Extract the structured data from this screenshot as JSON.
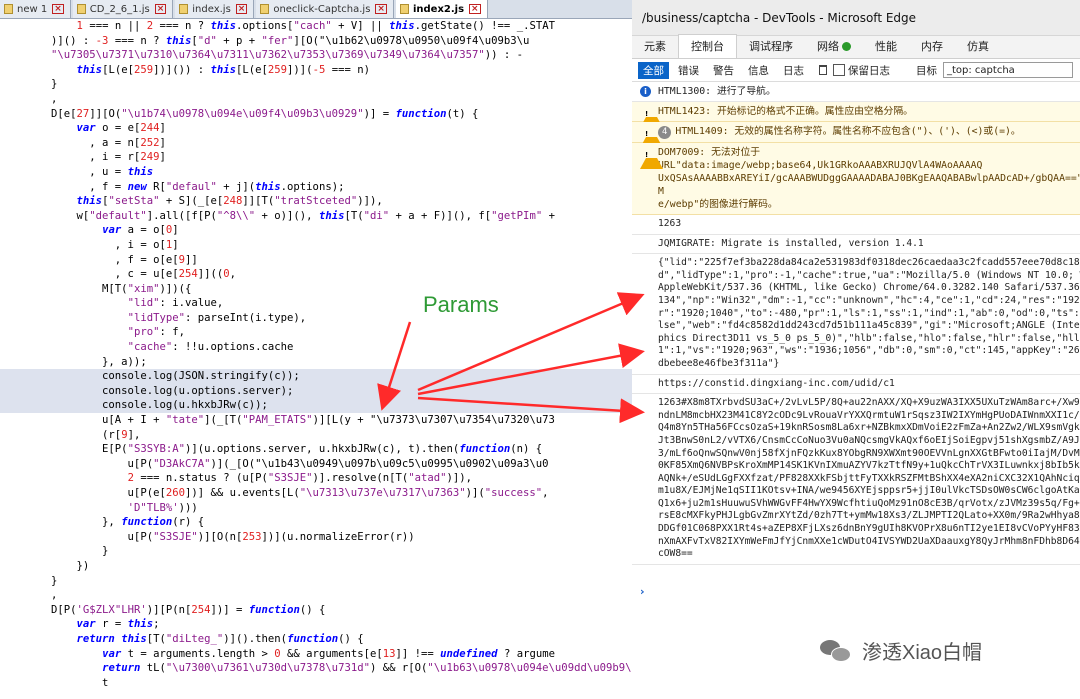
{
  "editor": {
    "tabs": [
      {
        "label": "new 1",
        "active": false
      },
      {
        "label": "CD_2_6_1.js",
        "active": false
      },
      {
        "label": "index.js",
        "active": false
      },
      {
        "label": "oneclick-Captcha.js",
        "active": false
      },
      {
        "label": "index2.js",
        "active": true
      }
    ],
    "lines": [
      "            1 === n || 2 === n ? this.options[\"cach\" + V] || this.getState() !== _.STAT",
      "        )]() : -3 === n ? this[\"d\" + p + \"fer\"][O(\"\\u1b62\\u0978\\u0950\\u09f4\\u09b3\\u",
      "        \"\\u7305\\u7371\\u7310\\u7364\\u7311\\u7362\\u7353\\u7369\\u7349\\u7364\\u7357\")) : -",
      "            this[L(e[259])]()) : this[L(e[259])](-5 === n)",
      "        }",
      "        ,",
      "        D[e[27]][O(\"\\u1b74\\u0978\\u094e\\u09f4\\u09b3\\u0929\")] = function(t) {",
      "            var o = e[244]",
      "              , a = n[252]",
      "              , i = r[249]",
      "              , u = this",
      "              , f = new R[\"defaul\" + j](this.options);",
      "            this[\"setSta\" + S](_[e[248]][T(\"tratStceted\")]),",
      "            w[\"default\"].all([f[P(\"^8\\\\\" + o)](), this[T(\"di\" + a + F)](), f[\"getPIm\" +",
      "                var a = o[0]",
      "                  , i = o[1]",
      "                  , f = o[e[9]]",
      "                  , c = u[e[254]]((0,",
      "                M[T(\"xim\")])({",
      "                    \"lid\": i.value,",
      "                    \"lidType\": parseInt(i.type),",
      "                    \"pro\": f,",
      "                    \"cache\": !!u.options.cache",
      "                }, a));",
      "                console.log(JSON.stringify(c));",
      "                console.log(u.options.server);",
      "                console.log(u.hkxbJRw(c));",
      "                u[A + I + \"tate\"](_[T(\"PAM_ETATS\")][L(y + \"\\u7373\\u7307\\u7354\\u7320\\u73",
      "                (r[9],",
      "                E[P(\"S3SYB:A\")](u.options.server, u.hkxbJRw(c), t).then(function(n) {",
      "                    u[P(\"D3AkC7A\")](_[O(\"\\u1b43\\u0949\\u097b\\u09c5\\u0995\\u0902\\u09a3\\u0",
      "                    2 === n.status ? (u[P(\"S3SJE\")].resolve(n[T(\"atad\")]),",
      "                    u[P(e[260])] && u.events[L(\"\\u7313\\u737e\\u7317\\u7363\")](\"success\",",
      "                    'D\"TLB%')))",
      "                }, function(r) {",
      "                    u[P(\"S3SJE\")][O(n[253])](u.normalizeError(r))",
      "                }",
      "            })",
      "        }",
      "        ,",
      "        D[P('G$ZLX\"LHR')][P(n[254])] = function() {",
      "            var r = this;",
      "            return this[T(\"diLteg_\")]().then(function() {",
      "                var t = arguments.length > 0 && arguments[e[13]] !== undefined ? argume",
      "                return tL(\"\\u7300\\u7361\\u730d\\u7378\\u731d\") && r[O(\"\\u1b63\\u0978\\u094e\\u09dd\\u09b9\\u0939\")](t.value),",
      "                t"
    ]
  },
  "overlay": {
    "params_label": "Params"
  },
  "devtools": {
    "title": "/business/captcha - DevTools - Microsoft Edge",
    "tabs": [
      "元素",
      "控制台",
      "调试程序",
      "网络",
      "性能",
      "内存",
      "仿真"
    ],
    "active_tab": "控制台",
    "filters": [
      "全部",
      "错误",
      "警告",
      "信息",
      "日志"
    ],
    "preserve_log": "保留日志",
    "target_label": "目标",
    "target_value": "_top: captcha",
    "messages": [
      {
        "type": "info",
        "text": "HTML1300: 进行了导航。"
      },
      {
        "type": "warn",
        "text": "HTML1423: 开始标记的格式不正确。属性应由空格分隔。"
      },
      {
        "type": "warn",
        "count": "4",
        "text": "HTML1409: 无效的属性名称字符。属性名称不应包含(\")、(')、(<)或(=)。"
      },
      {
        "type": "warn",
        "text": "DOM7009: 无法对位于 URL\"data:image/webp;base64,Uk1GRkoAAABXRUJQVlA4WAoAAAAQ\nUxQSAsAAAABBxAREYiI/gcAAABWUDggGAAAADABAJ0BKgEAAQABABwlpAADcAD+/gbQAA==\"且 M\ne/webp\"的图像进行解码。"
      }
    ],
    "log_1263": "1263",
    "jqmigrate": "JQMIGRATE: Migrate is installed, version 1.4.1",
    "json_lines": [
      "{\"lid\":\"225f7ef3ba228da84ca2e531983df0318dec26caedaa3c2fcadd557eee70d8c18",
      "d\",\"lidType\":1,\"pro\":-1,\"cache\":true,\"ua\":\"Mozilla/5.0 (Windows NT 10.0; Wi",
      "AppleWebKit/537.36 (KHTML, like Gecko) Chrome/64.0.3282.140 Safari/537.36 E",
      "134\",\"np\":\"Win32\",\"dm\":-1,\"cc\":\"unknown\",\"hc\":4,\"ce\":1,\"cd\":24,\"res\":\"1920;",
      "r\":\"1920;1040\",\"to\":-480,\"pr\":1,\"ls\":1,\"ss\":1,\"ind\":1,\"ab\":0,\"od\":0,\"ts\":\"0",
      "lse\",\"web\":\"fd4c8582d1dd243cd7d51b111a45c839\",\"gi\":\"Microsoft;ANGLE (Intel(",
      "phics Direct3D11 vs_5_0 ps_5_0)\",\"hlb\":false,\"hlo\":false,\"hlr\":false,\"hll\":",
      "1\":1,\"vs\":\"1920;963\",\"ws\":\"1936;1056\",\"db\":0,\"sm\":0,\"ct\":145,\"appKey\":\"26ba",
      "dbebee8e46fbe3f311a\"}"
    ],
    "server_url": "https://constid.dingxiang-inc.com/udid/c1",
    "encoded_lines": [
      "1263#X8m8TXrbvdSU3aC+/2vLvL5P/8Q+au22nAXX/XQ+X9uzWA3IXX5UXuTzWAm8arc+/Xw9v",
      "ndnLM8mcbHX23M41C8Y2cODc9LvRouaVrYXXQrmtuW1rSqsz3IW2IXYmHgPUoDAIWnmXXI1c/1m",
      "Q4m8Yn5THa56FCcsOzaS+19knRSosm8La6xr+NZBkmxXDmVoiE2zFmZa+An2Zw2/WLX9smVgk1C",
      "Jt3BnwS0nL2/vVTX6/CnsmCcCoNuo3Vu0aNQcsmgVkAQxf6oEIjSoiEgpvj51shXgsmbZ/A9JO6o",
      "3/mLf6oQnwSQnwV0nj58fXjnFQzkKux8YObgRN9XWXmt90OEVVnLgnXXGtBFwto0iIajM/DvM/g",
      "0KF85XmQ6NVBPsKroXmMP14SK1KVnIXmuAZYV7kzTtfN9y+1uQkcChTrVX3ILuwnkxj8bIb5kSi",
      "AQNk+/eSUdLGgFXXfzat/PF828XXkFSbjttFyTXXkRSZFMtBShXX4eXA2niCXC32X1QAhNciqJu",
      "m1u8X/EJMjNe1qSII1KOtsv+INA/we9456XYEjsppsr5+jjI0ulVkcTSDsOW0sCW6clgoAtKacE",
      "Q1x6+ju2m1sHuuwuSVhWWGvFF4HwYX9WcfhtiuQoMz91nO8cE3B/qrVotx/zJVMz39s5q/Fg+si",
      "rsE8cMXFkyPHJLgbGvZmrXYtZd/0zh7Tt+ymMw18Xs3/ZLJMPTI2QLato+XX0m/9Ra2wHhya8ay",
      "DDGf01C068PXX1Rt4s+aZEP8XFjLXsz6dnBnY9gUIh8KVOPrX8u6nTI2ye1EI8vCVoPYyHF83Xm",
      "nXmAXFvTxV82IXYmWeFmJfYjCnmXXe1cWDutO4IVSYWD2UaXDaauxgY8QyJrMhm8nFDhb8D645D",
      "cOW8=="
    ]
  },
  "watermark": {
    "text": "渗透Xiao白帽"
  },
  "colors": {
    "arrow": "#ff2a2a",
    "params": "#2e9a35",
    "accent": "#0a64c8"
  }
}
